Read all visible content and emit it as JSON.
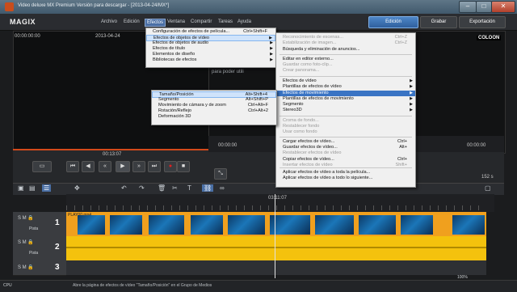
{
  "window": {
    "title": "Video deluxe MX Premium Versión para descargar - [2013-04-24/MX*]"
  },
  "menubar": {
    "logo": "MAGIX",
    "items": [
      "Archivo",
      "Edición",
      "Efectos",
      "Ventana",
      "Compartir",
      "Tareas",
      "Ayuda"
    ],
    "active_index": 2
  },
  "topbuttons": {
    "edicion": "Edición",
    "grabar": "Grabar",
    "exportacion": "Exportación"
  },
  "left_monitor": {
    "timecode_left": "00:00:00:00",
    "timecode_center": "2013-04-24",
    "timecode_bottom": "00:13:07"
  },
  "right_monitor": {
    "logo": "COLOON",
    "hint": "Por favor seleccione u vídeo para poder utili",
    "timecode_left": "00:00:00",
    "timecode_right": "00:00:00",
    "value_right": "152 s"
  },
  "timeline": {
    "ruler_time": "03:11:07",
    "tracks": [
      {
        "num": "1",
        "label": "Pista",
        "clip": "PLAY00.mp4"
      },
      {
        "num": "2",
        "label": "Pista",
        "clip": ""
      },
      {
        "num": "3",
        "label": "",
        "clip": ""
      }
    ]
  },
  "statusbar": {
    "left": "CPU",
    "text": "Abre la página de efectos de vídeo \"Tamaño/Posición\" en el Grupo de Medios",
    "zoom": "100%"
  },
  "menu_efectos": {
    "items": [
      {
        "label": "Configuración de efectos de película...",
        "shortcut": "Ctrl+Shift+F",
        "arrow": false,
        "state": "normal"
      },
      {
        "label": "Efectos de objetos de vídeo",
        "shortcut": "",
        "arrow": true,
        "state": "highlight"
      },
      {
        "label": "Efectos de objetos de audio",
        "shortcut": "",
        "arrow": true,
        "state": "normal"
      },
      {
        "label": "Efectos de título",
        "shortcut": "",
        "arrow": true,
        "state": "normal"
      },
      {
        "label": "Elementos de diseño",
        "shortcut": "",
        "arrow": true,
        "state": "normal"
      },
      {
        "label": "Bibliotecas de efectos",
        "shortcut": "",
        "arrow": true,
        "state": "normal"
      }
    ]
  },
  "menu_objetos": {
    "items": [
      {
        "label": "Reconocimiento de escenas...",
        "shortcut": "Ctrl+Z",
        "arrow": false,
        "state": "disabled"
      },
      {
        "label": "Estabilización de imagen...",
        "shortcut": "Ctrl+Z",
        "arrow": false,
        "state": "disabled"
      },
      {
        "label": "Búsqueda y eliminación de anuncios...",
        "shortcut": "",
        "arrow": false,
        "state": "normal"
      },
      {
        "label": "Editar en editor externo...",
        "shortcut": "",
        "arrow": false,
        "state": "normal"
      },
      {
        "label": "Guardar como foto-clip...",
        "shortcut": "",
        "arrow": false,
        "state": "disabled"
      },
      {
        "label": "Crear panorama...",
        "shortcut": "",
        "arrow": false,
        "state": "disabled"
      },
      {
        "label": "Efectos de vídeo",
        "shortcut": "",
        "arrow": true,
        "state": "normal"
      },
      {
        "label": "Plantillas de efectos de vídeo",
        "shortcut": "",
        "arrow": true,
        "state": "normal"
      },
      {
        "label": "Efectos de movimiento",
        "shortcut": "",
        "arrow": true,
        "state": "highlight"
      },
      {
        "label": "Plantillas de efectos de movimiento",
        "shortcut": "",
        "arrow": true,
        "state": "normal"
      },
      {
        "label": "Segmento",
        "shortcut": "",
        "arrow": true,
        "state": "normal"
      },
      {
        "label": "Stereo3D",
        "shortcut": "",
        "arrow": true,
        "state": "normal"
      },
      {
        "label": "Croma de fondo...",
        "shortcut": "",
        "arrow": false,
        "state": "disabled"
      },
      {
        "label": "Restablecer fondo",
        "shortcut": "",
        "arrow": false,
        "state": "disabled"
      },
      {
        "label": "Usar como fondo",
        "shortcut": "",
        "arrow": false,
        "state": "disabled"
      },
      {
        "label": "Cargar efectos de vídeo...",
        "shortcut": "Ctrl+",
        "arrow": false,
        "state": "normal"
      },
      {
        "label": "Guardar efectos de vídeo...",
        "shortcut": "Alt+",
        "arrow": false,
        "state": "normal"
      },
      {
        "label": "Restablecer efectos de vídeo",
        "shortcut": "",
        "arrow": false,
        "state": "disabled"
      },
      {
        "label": "Copiar efectos de vídeo...",
        "shortcut": "Ctrl+",
        "arrow": false,
        "state": "normal"
      },
      {
        "label": "Insertar efectos de vídeo",
        "shortcut": "Shift+",
        "arrow": false,
        "state": "disabled"
      },
      {
        "label": "Aplicar efectos de vídeo a toda la película...",
        "shortcut": "",
        "arrow": false,
        "state": "normal"
      },
      {
        "label": "Aplicar efectos de vídeo a todo lo siguiente...",
        "shortcut": "",
        "arrow": false,
        "state": "normal"
      }
    ]
  },
  "menu_movimiento": {
    "items": [
      {
        "label": "Tamaño/Posición",
        "shortcut": "Alt+Shift+4",
        "state": "highlight"
      },
      {
        "label": "Segmento",
        "shortcut": "Alt+Shift+P",
        "state": "normal"
      },
      {
        "label": "Movimiento de cámara y de zoom",
        "shortcut": "Ctrl+Alt+F",
        "state": "normal"
      },
      {
        "label": "Rotación/Reflejo",
        "shortcut": "Ctrl+Alt+2",
        "state": "normal"
      },
      {
        "label": "Deformación 3D",
        "shortcut": "",
        "state": "normal"
      }
    ]
  }
}
